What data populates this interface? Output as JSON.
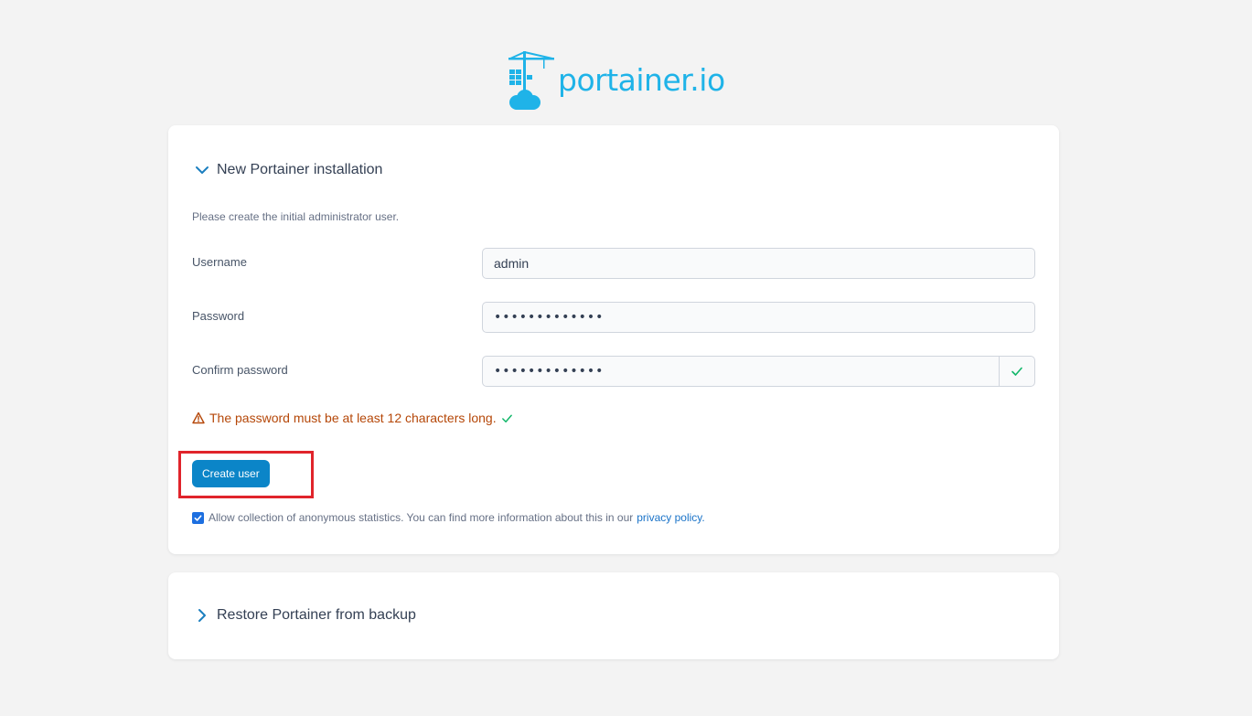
{
  "brand": {
    "logo_text": "portainer.io",
    "color": "#1fb3e8"
  },
  "install": {
    "title": "New Portainer installation",
    "intro": "Please create the initial administrator user.",
    "username_label": "Username",
    "username_value": "admin",
    "password_label": "Password",
    "password_value": "•••••••••••••",
    "confirm_label": "Confirm password",
    "confirm_value": "•••••••••••••",
    "warning_text": "The password must be at least 12 characters long.",
    "submit_label": "Create user",
    "consent_text": "Allow collection of anonymous statistics. You can find more information about this in our",
    "consent_link": "privacy policy.",
    "consent_checked": true
  },
  "restore": {
    "title": "Restore Portainer from backup"
  },
  "icons": {
    "expanded": "chevron-down-icon",
    "collapsed": "chevron-right-icon",
    "warning": "warning-triangle-icon",
    "valid": "check-icon"
  },
  "colors": {
    "accent": "#0b85c8",
    "warning": "#b54708",
    "success": "#12b76a",
    "highlight": "#e0242b"
  }
}
